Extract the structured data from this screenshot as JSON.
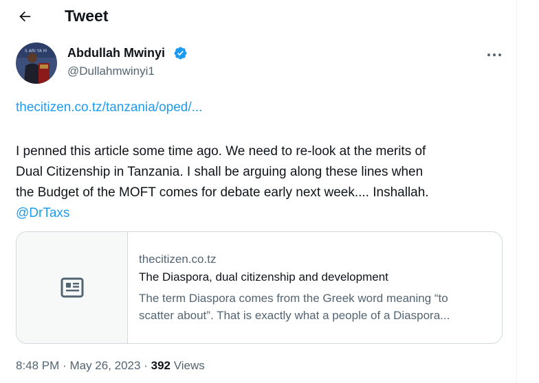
{
  "header": {
    "title": "Tweet",
    "back_icon": "arrow-left-icon"
  },
  "author": {
    "name": "Abdullah Mwinyi",
    "handle": "@Dullahmwinyi1",
    "verified_color": "#1d9bf0",
    "avatar_caption": "S ARI YA M"
  },
  "tweet": {
    "link": "thecitizen.co.tz/tanzania/oped/...",
    "text_lines": [
      "I penned this article some time ago. We need to re-look at the merits of",
      "Dual Citizenship in Tanzania. I shall be arguing along these lines when",
      "the Budget of the MOFT comes for debate early next week.... Inshallah."
    ],
    "mention": "@DrTaxs"
  },
  "card": {
    "domain": "thecitizen.co.tz",
    "title": "The Diaspora, dual citizenship and development",
    "description_lines": [
      "The term Diaspora comes from the Greek word meaning “to",
      "scatter about”. That is exactly what a people of a Diaspora..."
    ],
    "icon": "news-article-icon"
  },
  "meta": {
    "time": "8:48 PM",
    "separator": "·",
    "date": "May 26, 2023",
    "views_count": "392",
    "views_label": "Views"
  },
  "colors": {
    "link": "#1d9bf0",
    "secondary": "#536471",
    "text": "#0f1419",
    "border": "#cfd9de"
  }
}
